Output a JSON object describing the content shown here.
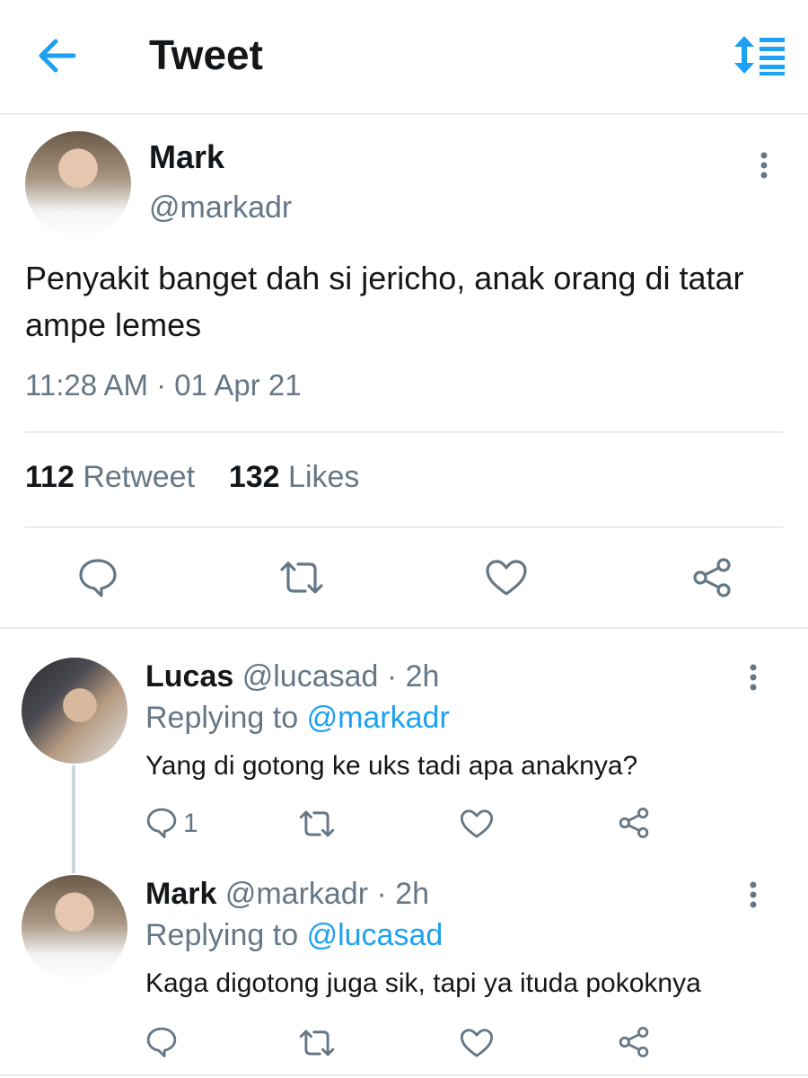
{
  "header": {
    "title": "Tweet",
    "back_icon": "arrow-left-icon",
    "sort_icon": "sort-lines-icon",
    "accent": "#1da1f2"
  },
  "tweet": {
    "name": "Mark",
    "handle": "@markadr",
    "text": "Penyakit banget dah si jericho, anak orang di tatar ampe lemes",
    "time": "11:28 AM · 01 Apr 21",
    "retweets": "112",
    "retweets_label": "Retweet",
    "likes": "132",
    "likes_label": "Likes"
  },
  "replies": [
    {
      "name": "Lucas",
      "handle_time": "@lucasad · 2h",
      "replying_prefix": "Replying to",
      "replying_to": "@markadr",
      "text": "Yang di gotong ke uks tadi apa anaknya?",
      "reply_count": "1"
    },
    {
      "name": "Mark",
      "handle_time": "@markadr · 2h",
      "replying_prefix": "Replying to",
      "replying_to": "@lucasad",
      "text": "Kaga digotong juga sik, tapi ya ituda pokoknya",
      "reply_count": ""
    }
  ],
  "colors": {
    "text": "#14171a",
    "secondary": "#657786",
    "divider": "#e6ecf0",
    "link": "#1da1f2"
  }
}
